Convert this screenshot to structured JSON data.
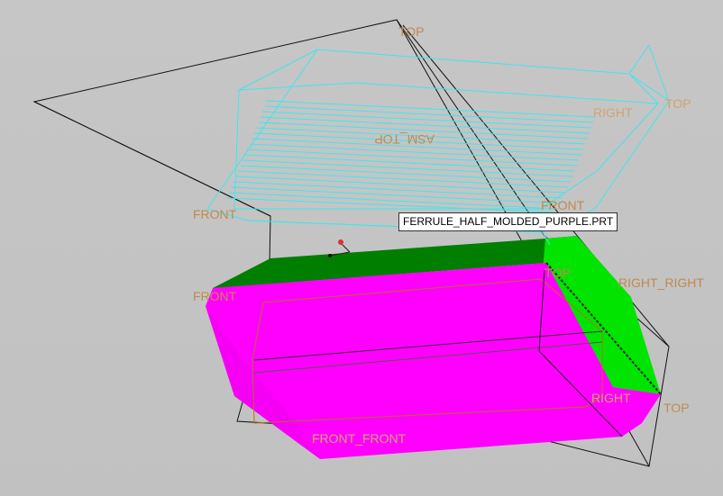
{
  "tooltip": {
    "text": "FERRULE_HALF_MOLDED_PURPLE.PRT"
  },
  "labels": {
    "top_a": "TOP",
    "top_b": "TOP",
    "top_c": "TOP",
    "top_d": "TOP",
    "right_a": "RIGHT",
    "right_b": "RIGHT",
    "right_right": "RIGHT_RIGHT",
    "front_a": "FRONT",
    "front_b": "FRONT",
    "front_c": "FRONT",
    "front_front": "FRONT_FRONT",
    "asm_top": "ASM_TOP"
  },
  "colors": {
    "wire_cyan": "#3ee6ee",
    "magenta": "#ff00ff",
    "green_side": "#00e400",
    "green_top": "#00a000",
    "datum_line": "#111111",
    "label": "#c08a4e",
    "background": "#c4c4c4"
  }
}
